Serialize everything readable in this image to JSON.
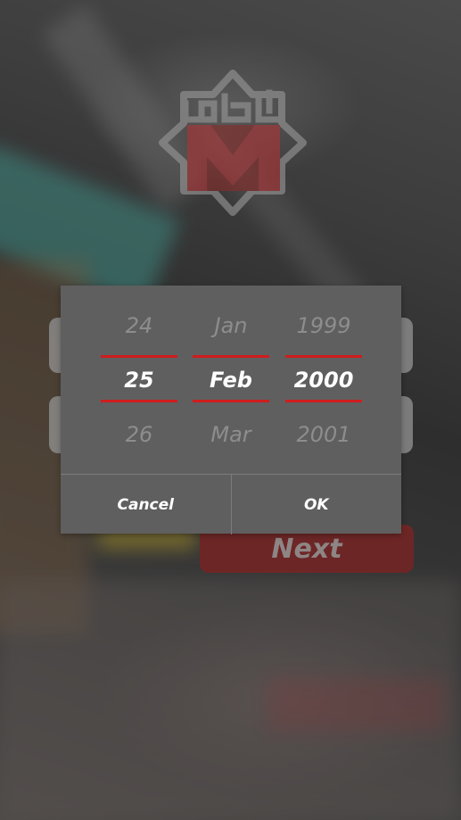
{
  "app": {
    "logo_text": "مترو",
    "logo_letter": "M"
  },
  "form": {
    "next_label": "Next"
  },
  "date_picker": {
    "day": {
      "prev": "24",
      "selected": "25",
      "next": "26"
    },
    "month": {
      "prev": "Jan",
      "selected": "Feb",
      "next": "Mar"
    },
    "year": {
      "prev": "1999",
      "selected": "2000",
      "next": "2001"
    },
    "cancel_label": "Cancel",
    "ok_label": "OK"
  },
  "colors": {
    "accent_red": "#d01c1c",
    "dialog_bg": "#5f5f5f",
    "next_button_bg": "#6d2626"
  }
}
